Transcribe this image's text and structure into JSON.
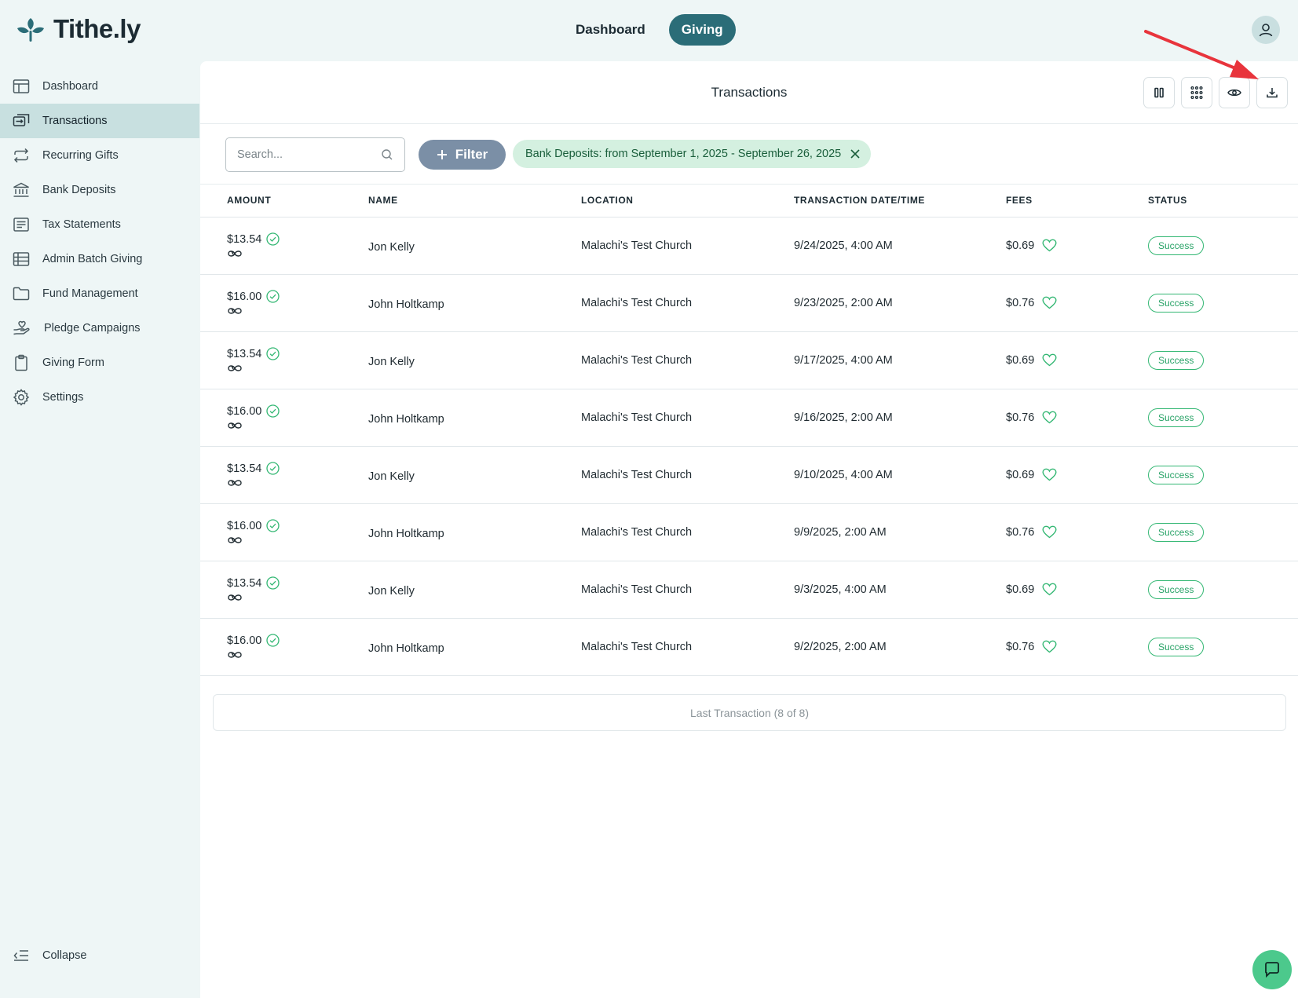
{
  "brand": {
    "name": "Tithe.ly"
  },
  "topnav": {
    "dashboard": "Dashboard",
    "giving": "Giving"
  },
  "sidebar": {
    "items": [
      {
        "label": "Dashboard",
        "icon": "layout-icon"
      },
      {
        "label": "Transactions",
        "icon": "transfer-icon"
      },
      {
        "label": "Recurring Gifts",
        "icon": "repeat-icon"
      },
      {
        "label": "Bank Deposits",
        "icon": "bank-icon"
      },
      {
        "label": "Tax Statements",
        "icon": "receipt-icon"
      },
      {
        "label": "Admin Batch Giving",
        "icon": "table-icon"
      },
      {
        "label": "Fund Management",
        "icon": "folder-icon"
      },
      {
        "label": "Pledge Campaigns",
        "icon": "hand-heart-icon"
      },
      {
        "label": "Giving Form",
        "icon": "clipboard-icon"
      },
      {
        "label": "Settings",
        "icon": "gear-icon"
      }
    ],
    "active": "Transactions",
    "collapse": "Collapse"
  },
  "main": {
    "title": "Transactions",
    "search_placeholder": "Search...",
    "filter_label": "Filter",
    "active_filter": "Bank Deposits: from September 1, 2025 - September 26, 2025",
    "columns": [
      "AMOUNT",
      "NAME",
      "LOCATION",
      "TRANSACTION DATE/TIME",
      "FEES",
      "STATUS"
    ],
    "rows": [
      {
        "amount": "$13.54",
        "name": "Jon Kelly",
        "location": "Malachi's Test Church",
        "date": "9/24/2025, 4:00 AM",
        "fees": "$0.69",
        "status": "Success"
      },
      {
        "amount": "$16.00",
        "name": "John Holtkamp",
        "location": "Malachi's Test Church",
        "date": "9/23/2025, 2:00 AM",
        "fees": "$0.76",
        "status": "Success"
      },
      {
        "amount": "$13.54",
        "name": "Jon Kelly",
        "location": "Malachi's Test Church",
        "date": "9/17/2025, 4:00 AM",
        "fees": "$0.69",
        "status": "Success"
      },
      {
        "amount": "$16.00",
        "name": "John Holtkamp",
        "location": "Malachi's Test Church",
        "date": "9/16/2025, 2:00 AM",
        "fees": "$0.76",
        "status": "Success"
      },
      {
        "amount": "$13.54",
        "name": "Jon Kelly",
        "location": "Malachi's Test Church",
        "date": "9/10/2025, 4:00 AM",
        "fees": "$0.69",
        "status": "Success"
      },
      {
        "amount": "$16.00",
        "name": "John Holtkamp",
        "location": "Malachi's Test Church",
        "date": "9/9/2025, 2:00 AM",
        "fees": "$0.76",
        "status": "Success"
      },
      {
        "amount": "$13.54",
        "name": "Jon Kelly",
        "location": "Malachi's Test Church",
        "date": "9/3/2025, 4:00 AM",
        "fees": "$0.69",
        "status": "Success"
      },
      {
        "amount": "$16.00",
        "name": "John Holtkamp",
        "location": "Malachi's Test Church",
        "date": "9/2/2025, 2:00 AM",
        "fees": "$0.76",
        "status": "Success"
      }
    ],
    "footer": "Last Transaction (8 of 8)"
  },
  "colors": {
    "accent": "#2b6d78",
    "success": "#33b773",
    "chip_bg": "#d4f0e0",
    "arrow": "#e8343c"
  }
}
